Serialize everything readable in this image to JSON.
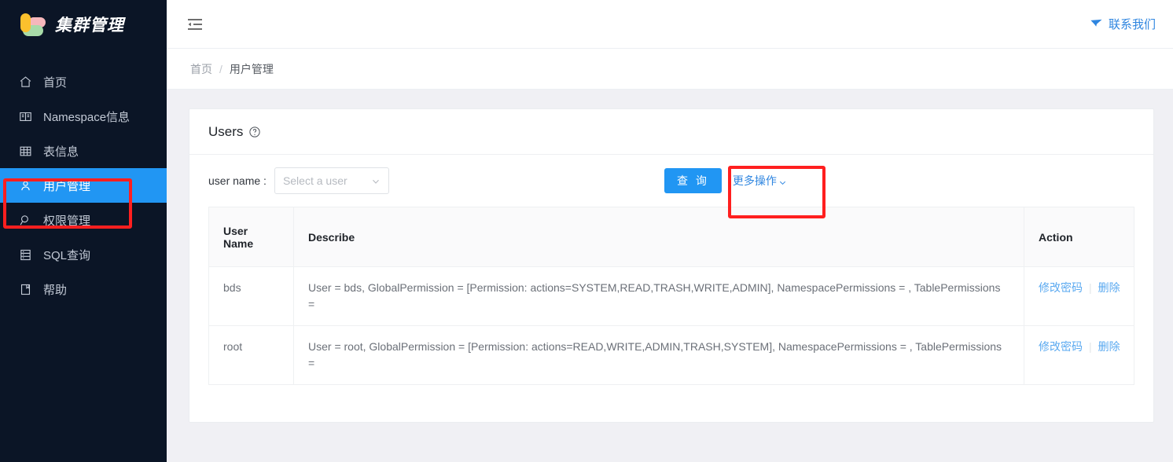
{
  "brand": {
    "title": "集群管理",
    "logo_colors": {
      "yellow": "#fbc02d",
      "pink": "#f6b7bb",
      "green": "#a8dba8"
    }
  },
  "sidebar": {
    "background": "#0b1526",
    "active_color": "#2196f3",
    "items": [
      {
        "label": "首页",
        "icon": "home-icon",
        "active": false
      },
      {
        "label": "Namespace信息",
        "icon": "book-icon",
        "active": false
      },
      {
        "label": "表信息",
        "icon": "table-grid-icon",
        "active": false
      },
      {
        "label": "用户管理",
        "icon": "user-icon",
        "active": true
      },
      {
        "label": "权限管理",
        "icon": "magnifier-icon",
        "active": false
      },
      {
        "label": "SQL查询",
        "icon": "database-icon",
        "active": false
      },
      {
        "label": "帮助",
        "icon": "manual-icon",
        "active": false
      }
    ]
  },
  "topbar": {
    "fold_icon": "menu-fold-icon",
    "contact_label": "联系我们",
    "contact_icon": "send-icon",
    "contact_color": "#2f86e0"
  },
  "breadcrumb": {
    "home": "首页",
    "separator": "/",
    "current": "用户管理"
  },
  "card": {
    "title": "Users",
    "help_icon": "question-circle-icon"
  },
  "filter": {
    "label": "user name :",
    "select_placeholder": "Select a user",
    "select_value": "",
    "chevron_icon": "chevron-down-icon",
    "query_button": "查 询",
    "more_actions": "更多操作",
    "more_actions_icon": "chevron-down-icon"
  },
  "table": {
    "columns": [
      "User Name",
      "Describe",
      "Action"
    ],
    "rows": [
      {
        "user_name": "bds",
        "describe": "User = bds, GlobalPermission = [Permission: actions=SYSTEM,READ,TRASH,WRITE,ADMIN], NamespacePermissions = , TablePermissions =",
        "action_edit": "修改密码",
        "action_divider": "|",
        "action_delete": "删除"
      },
      {
        "user_name": "root",
        "describe": "User = root, GlobalPermission = [Permission: actions=READ,WRITE,ADMIN,TRASH,SYSTEM], NamespacePermissions = , TablePermissions =",
        "action_edit": "修改密码",
        "action_divider": "|",
        "action_delete": "删除"
      }
    ]
  },
  "annotations": [
    {
      "name": "sidebar-user-management-highlight",
      "color": "#ff1f1f"
    },
    {
      "name": "more-actions-highlight",
      "color": "#ff1f1f"
    }
  ]
}
